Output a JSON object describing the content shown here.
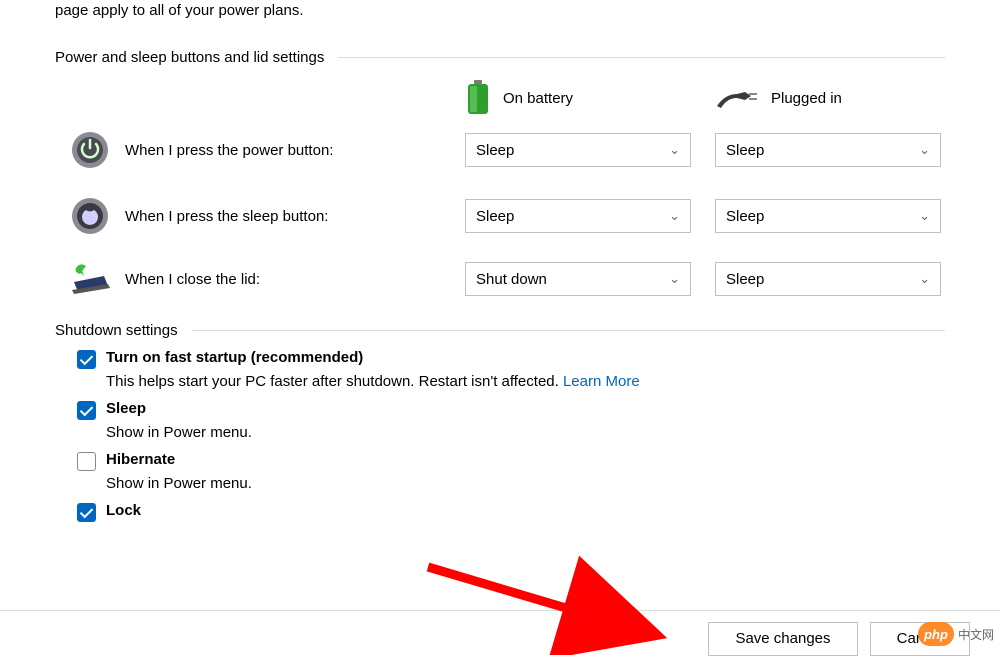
{
  "intro_line": "page apply to all of your power plans.",
  "sections": {
    "power_buttons": "Power and sleep buttons and lid settings",
    "shutdown": "Shutdown settings"
  },
  "columns": {
    "battery": "On battery",
    "plugged": "Plugged in"
  },
  "rows": {
    "power": {
      "label": "When I press the power button:",
      "battery": "Sleep",
      "plugged": "Sleep"
    },
    "sleep": {
      "label": "When I press the sleep button:",
      "battery": "Sleep",
      "plugged": "Sleep"
    },
    "lid": {
      "label": "When I close the lid:",
      "battery": "Shut down",
      "plugged": "Sleep"
    }
  },
  "shutdown": {
    "fast": {
      "title": "Turn on fast startup (recommended)",
      "desc": "This helps start your PC faster after shutdown. Restart isn't affected. ",
      "link": "Learn More",
      "checked": true
    },
    "sleep": {
      "title": "Sleep",
      "desc": "Show in Power menu.",
      "checked": true
    },
    "hibernate": {
      "title": "Hibernate",
      "desc": "Show in Power menu.",
      "checked": false
    },
    "lock": {
      "title": "Lock",
      "checked": true
    }
  },
  "buttons": {
    "save": "Save changes",
    "cancel": "Cancel"
  },
  "watermark": "中文网"
}
